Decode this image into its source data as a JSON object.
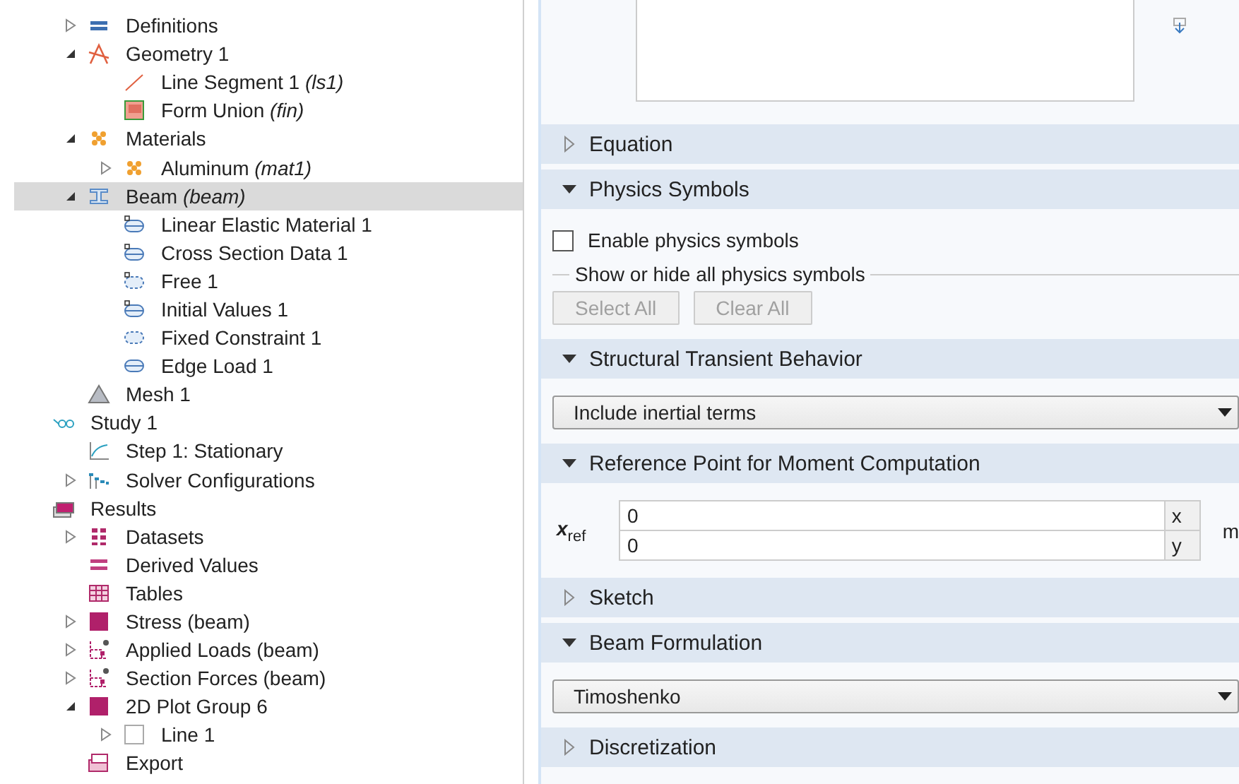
{
  "tree": {
    "component_items": [
      {
        "label": "Definitions",
        "kind": "definitions",
        "expanded": false,
        "selected": false
      },
      {
        "label": "Geometry 1",
        "kind": "geometry",
        "expanded": true,
        "selected": false,
        "children": [
          {
            "label": "Line Segment 1  *(ls1)*",
            "kind": "line",
            "selected": false
          },
          {
            "label": "Form Union  *(fin)*",
            "kind": "union",
            "selected": false
          }
        ]
      },
      {
        "label": "Materials",
        "kind": "materials",
        "expanded": true,
        "selected": false,
        "children": [
          {
            "label": "Aluminum  *(mat1)*",
            "kind": "materials",
            "expanded": false,
            "selected": false
          }
        ]
      },
      {
        "label": "Beam  *(beam)*",
        "kind": "beam",
        "expanded": true,
        "selected": true,
        "children": [
          {
            "label": "Linear Elastic Material 1",
            "kind": "feature",
            "selected": false
          },
          {
            "label": "Cross Section Data 1",
            "kind": "feature",
            "selected": false
          },
          {
            "label": "Free 1",
            "kind": "boundary",
            "selected": false
          },
          {
            "label": "Initial Values 1",
            "kind": "feature",
            "selected": false
          },
          {
            "label": "Fixed Constraint 1",
            "kind": "constraint",
            "selected": false
          },
          {
            "label": "Edge Load 1",
            "kind": "load",
            "selected": false
          }
        ]
      },
      {
        "label": "Mesh 1",
        "kind": "mesh",
        "selected": false
      }
    ],
    "items": [
      {
        "label": "Study 1",
        "kind": "study",
        "selected": false,
        "children": [
          {
            "label": "Step 1: Stationary",
            "kind": "step",
            "selected": false
          },
          {
            "label": "Solver Configurations",
            "kind": "solver",
            "expanded": false,
            "selected": false
          }
        ]
      },
      {
        "label": "Results",
        "kind": "results",
        "selected": false,
        "children": [
          {
            "label": "Datasets",
            "kind": "datasets",
            "expanded": false,
            "selected": false
          },
          {
            "label": "Derived Values",
            "kind": "derived",
            "selected": false
          },
          {
            "label": "Tables",
            "kind": "tables",
            "selected": false
          },
          {
            "label": "Stress (beam)",
            "kind": "plot",
            "expanded": false,
            "selected": false
          },
          {
            "label": "Applied Loads (beam)",
            "kind": "loads",
            "expanded": false,
            "selected": false
          },
          {
            "label": "Section Forces (beam)",
            "kind": "loads",
            "expanded": false,
            "selected": false
          },
          {
            "label": "2D Plot Group 6",
            "kind": "plot",
            "expanded": true,
            "selected": false,
            "children": [
              {
                "label": "Line 1",
                "kind": "line-plot",
                "expanded": false,
                "selected": false
              }
            ]
          },
          {
            "label": "Export",
            "kind": "export",
            "selected": false
          }
        ]
      }
    ]
  },
  "settings": {
    "sections": [
      {
        "title": "Equation",
        "expanded": false
      },
      {
        "title": "Physics Symbols",
        "expanded": true,
        "content": {
          "kind": "symbols",
          "checkbox": {
            "label": "Enable physics symbols",
            "checked": false
          },
          "group_label": "Show or hide all physics symbols",
          "buttons": [
            {
              "label": "Select All",
              "disabled": true
            },
            {
              "label": "Clear All",
              "disabled": true
            }
          ]
        }
      },
      {
        "title": "Structural Transient Behavior",
        "expanded": true,
        "content": {
          "kind": "select",
          "value": "Include inertial terms"
        }
      },
      {
        "title": "Reference Point for Moment Computation",
        "expanded": true,
        "content": {
          "kind": "vector",
          "symbol": "**x**$_{ref}$",
          "unit": "m",
          "components": [
            {
              "value": "0",
              "axis": "x"
            },
            {
              "value": "0",
              "axis": "y"
            }
          ]
        }
      },
      {
        "title": "Sketch",
        "expanded": false
      },
      {
        "title": "Beam Formulation",
        "expanded": true,
        "content": {
          "kind": "select",
          "value": "Timoshenko"
        }
      },
      {
        "title": "Discretization",
        "expanded": false
      }
    ]
  }
}
